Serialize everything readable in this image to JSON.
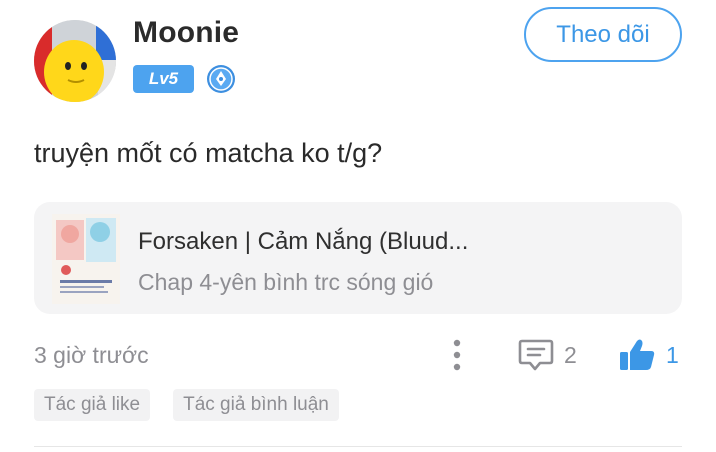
{
  "user": {
    "name": "Moonie",
    "level": "Lv5",
    "avatar_icon": "yellow-face-avatar",
    "medal_icon": "blue-pen-medal-icon"
  },
  "follow_button": {
    "label": "Theo dõi"
  },
  "post": {
    "text": "truyện mốt có matcha ko t/g?"
  },
  "story": {
    "title": "Forsaken | Cảm Nắng (Bluud...",
    "chapter": "Chap 4-yên bình trc sóng gió",
    "cover_icon": "story-cover-thumbnail"
  },
  "meta": {
    "time": "3 giờ trước",
    "comment_count": "2",
    "like_count": "1"
  },
  "tags": [
    {
      "label": "Tác giả like"
    },
    {
      "label": "Tác giả bình luận"
    }
  ],
  "colors": {
    "accent": "#4da3ef",
    "muted_text": "#8e8e93",
    "card_bg": "#f4f4f5"
  }
}
